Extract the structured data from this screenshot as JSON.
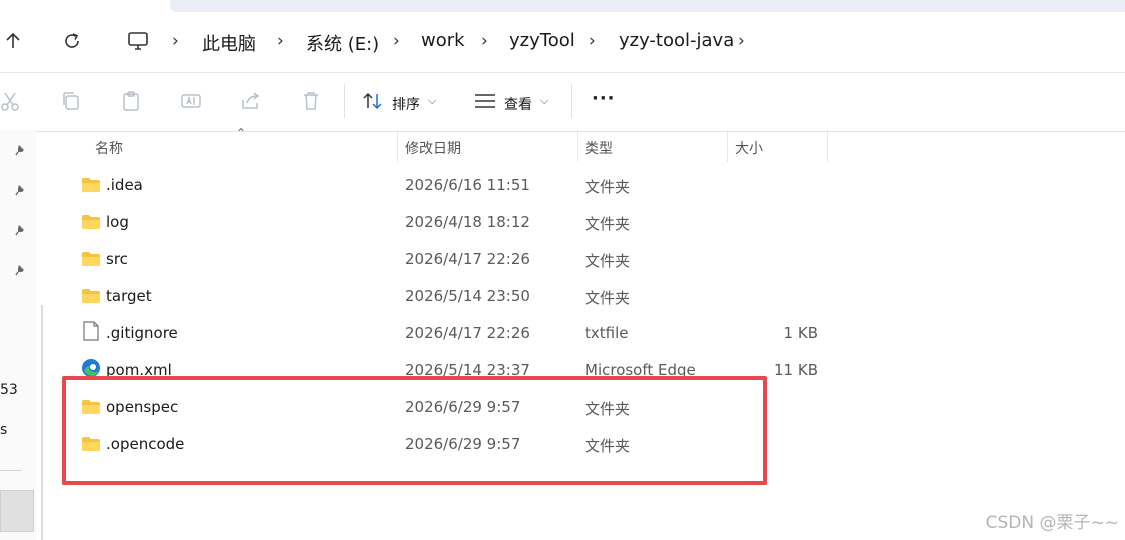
{
  "breadcrumb": [
    "此电脑",
    "系统 (E:)",
    "work",
    "yzyTool",
    "yzy-tool-java"
  ],
  "toolbar": {
    "sort_label": "排序",
    "view_label": "查看",
    "more_label": "···"
  },
  "columns": {
    "name": "名称",
    "modified": "修改日期",
    "type": "类型",
    "size": "大小"
  },
  "files": [
    {
      "name": ".idea",
      "modified": "2026/6/16 11:51",
      "type": "文件夹",
      "size": "",
      "icon": "folder-icon"
    },
    {
      "name": "log",
      "modified": "2026/4/18 18:12",
      "type": "文件夹",
      "size": "",
      "icon": "folder-icon"
    },
    {
      "name": "src",
      "modified": "2026/4/17 22:26",
      "type": "文件夹",
      "size": "",
      "icon": "folder-icon"
    },
    {
      "name": "target",
      "modified": "2026/5/14 23:50",
      "type": "文件夹",
      "size": "",
      "icon": "folder-icon"
    },
    {
      "name": ".gitignore",
      "modified": "2026/4/17 22:26",
      "type": "txtfile",
      "size": "1 KB",
      "icon": "file-icon"
    },
    {
      "name": "pom.xml",
      "modified": "2026/5/14 23:37",
      "type": "Microsoft Edge",
      "size": "11 KB",
      "icon": "edge-icon"
    },
    {
      "name": "openspec",
      "modified": "2026/6/29 9:57",
      "type": "文件夹",
      "size": "",
      "icon": "folder-icon"
    },
    {
      "name": ".opencode",
      "modified": "2026/6/29 9:57",
      "type": "文件夹",
      "size": "",
      "icon": "folder-icon"
    }
  ],
  "left_fragments": [
    "53",
    "s"
  ],
  "watermark": "CSDN @栗子~~",
  "colors": {
    "folder": "#f5c542",
    "highlight": "#e5484d",
    "edge_blue": "#1e7ad6",
    "edge_green": "#3cc36b"
  }
}
